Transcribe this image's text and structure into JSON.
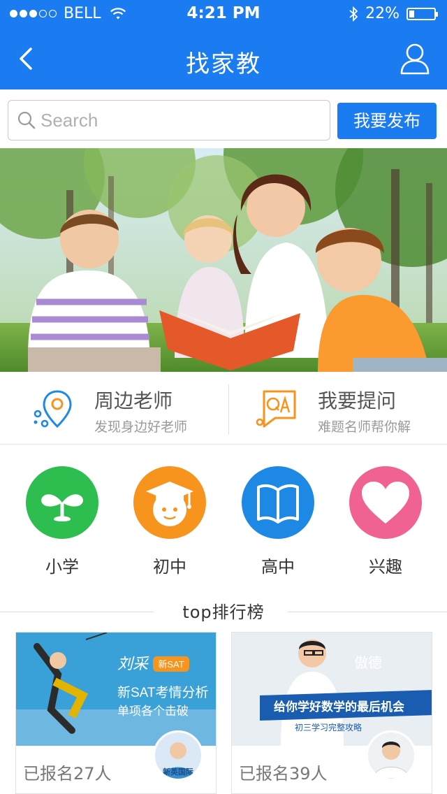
{
  "status_bar": {
    "carrier": "BELL",
    "time": "4:21 PM",
    "battery": "22%",
    "battery_level": 0.22
  },
  "nav": {
    "title": "找家教"
  },
  "search": {
    "placeholder": "Search",
    "value": "",
    "publish_label": "我要发布"
  },
  "features": [
    {
      "title": "周边老师",
      "subtitle": "发现身边好老师",
      "icon": "location-pin-icon"
    },
    {
      "title": "我要提问",
      "subtitle": "难题名师帮你解",
      "icon": "qa-icon"
    }
  ],
  "categories": [
    {
      "label": "小学",
      "icon": "sprout-icon",
      "color": "#2dbe4f"
    },
    {
      "label": "初中",
      "icon": "graduation-cap-icon",
      "color": "#f7941d"
    },
    {
      "label": "高中",
      "icon": "book-icon",
      "color": "#1e88e5"
    },
    {
      "label": "兴趣",
      "icon": "heart-icon",
      "color": "#f06292"
    }
  ],
  "ranking": {
    "title": "top排行榜",
    "cards": [
      {
        "count_text": "已报名27人",
        "thumb_text_1": "刘采",
        "thumb_badge": "新SAT",
        "thumb_text_2": "新SAT考情分析",
        "thumb_text_3": "单项各个击破",
        "avatar_text": "新英国际"
      },
      {
        "count_text": "已报名39人",
        "thumb_text_1": "傲德",
        "thumb_text_2": "给你学好数学的最后机会",
        "thumb_text_3": "初三学习完整攻略"
      }
    ]
  },
  "colors": {
    "primary": "#1a7cf0",
    "orange": "#f7941d"
  }
}
